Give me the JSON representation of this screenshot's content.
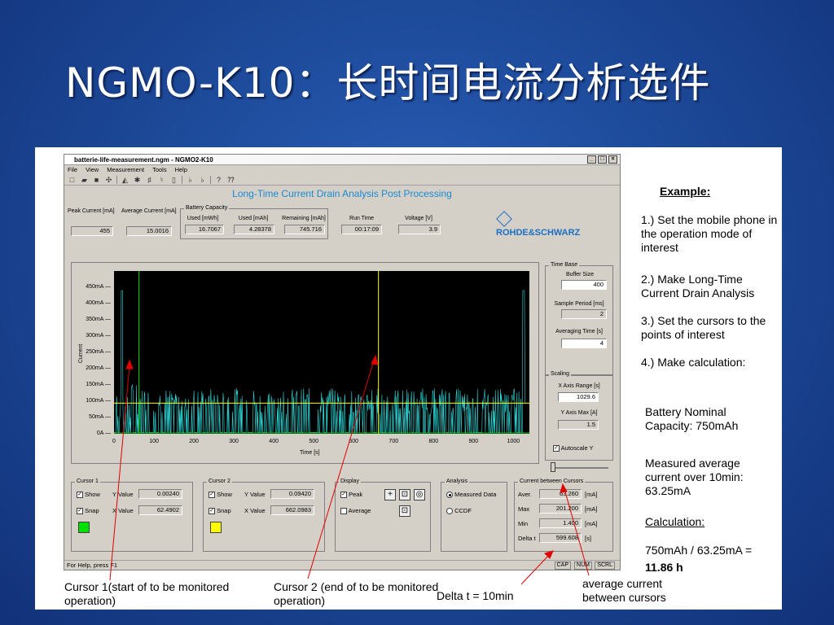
{
  "slide_title": "NGMO-K10：长时间电流分析选件",
  "window": {
    "title": "batterie-life-measurement.ngm - NGMO2-K10",
    "menu": [
      "File",
      "View",
      "Measurement",
      "Tools",
      "Help"
    ]
  },
  "app_heading": "Long-Time Current Drain Analysis Post Processing",
  "readouts": {
    "peak_current_label": "Peak Current [mA]",
    "peak_current": "455",
    "avg_current_label": "Average Current [mA]",
    "avg_current": "15.0016",
    "battery_capacity_label": "Battery Capacity",
    "used_mwh_label": "Used [mWh]",
    "used_mwh": "16.7067",
    "used_mah_label": "Used [mAh]",
    "used_mah": "4.28378",
    "remaining_label": "Remaining [mAh]",
    "remaining": "745.716",
    "runtime_label": "Run Time",
    "runtime": "00:17:09",
    "voltage_label": "Voltage [V]",
    "voltage": "3.9"
  },
  "brand": "ROHDE&SCHWARZ",
  "plot": {
    "y_ticks": [
      "450mA",
      "400mA",
      "350mA",
      "300mA",
      "250mA",
      "200mA",
      "150mA",
      "100mA",
      "50mA",
      "0A"
    ],
    "x_ticks": [
      "0",
      "100",
      "200",
      "300",
      "400",
      "500",
      "600",
      "700",
      "800",
      "900",
      "1000"
    ],
    "x_label": "Time [s]",
    "y_label": "Current"
  },
  "right_panel": {
    "time_base": "Time Base",
    "buffer_size_label": "Buffer Size",
    "buffer_size": "400",
    "sample_period_label": "Sample Period [ms]",
    "sample_period": "2",
    "averaging_time_label": "Averaging Time [s]",
    "averaging_time": "4",
    "scaling": "Scaling",
    "x_axis_range_label": "X Axis Range [s]",
    "x_axis_range": "1029.6",
    "y_axis_max_label": "Y Axis Max [A]",
    "y_axis_max": "1.5",
    "autoscale_label": "Autoscale Y"
  },
  "cursor1": {
    "legend": "Cursor 1",
    "show": "Show",
    "snap": "Snap",
    "yvalue_label": "Y Value",
    "yvalue": "0.00240",
    "xvalue_label": "X Value",
    "xvalue": "62.4902",
    "color": "#00e000"
  },
  "cursor2": {
    "legend": "Cursor 2",
    "show": "Show",
    "snap": "Snap",
    "yvalue_label": "Y Value",
    "yvalue": "0.09420",
    "xvalue_label": "X Value",
    "xvalue": "662.0983",
    "color": "#ffff00"
  },
  "display": {
    "legend": "Display",
    "peak": "Peak",
    "average": "Average"
  },
  "analysis": {
    "legend": "Analysis",
    "measured": "Measured Data",
    "ccdf": "CCDF"
  },
  "between": {
    "legend": "Current between Cursors",
    "aver_label": "Aver.",
    "aver": "63.260",
    "unit_ma": "[mA]",
    "max_label": "Max",
    "max": "201.200",
    "min_label": "Min",
    "min": "1.400",
    "delta_label": "Delta t",
    "delta": "599.608",
    "unit_s": "[s]"
  },
  "statusbar": {
    "help": "For Help, press F1",
    "cap": "CAP",
    "num": "NUM",
    "scrl": "SCRL"
  },
  "example": {
    "heading": "Example:",
    "step1": "1.) Set the mobile phone in the operation mode of interest",
    "step2": "2.) Make Long-Time Current Drain Analysis",
    "step3": "3.) Set the cursors to the points of interest",
    "step4": "4.) Make calculation:",
    "nominal": "Battery Nominal Capacity: 750mAh",
    "measured": "Measured average current over 10min: 63.25mA",
    "calc_heading": "Calculation:",
    "calc": "750mAh / 63.25mA =",
    "result": "11.86 h"
  },
  "captions": {
    "cursor1": "Cursor 1(start of to be monitored operation)",
    "cursor2": "Cursor 2 (end of to be monitored operation)",
    "delta": "Delta t = 10min",
    "avg": "average current between cursors"
  }
}
